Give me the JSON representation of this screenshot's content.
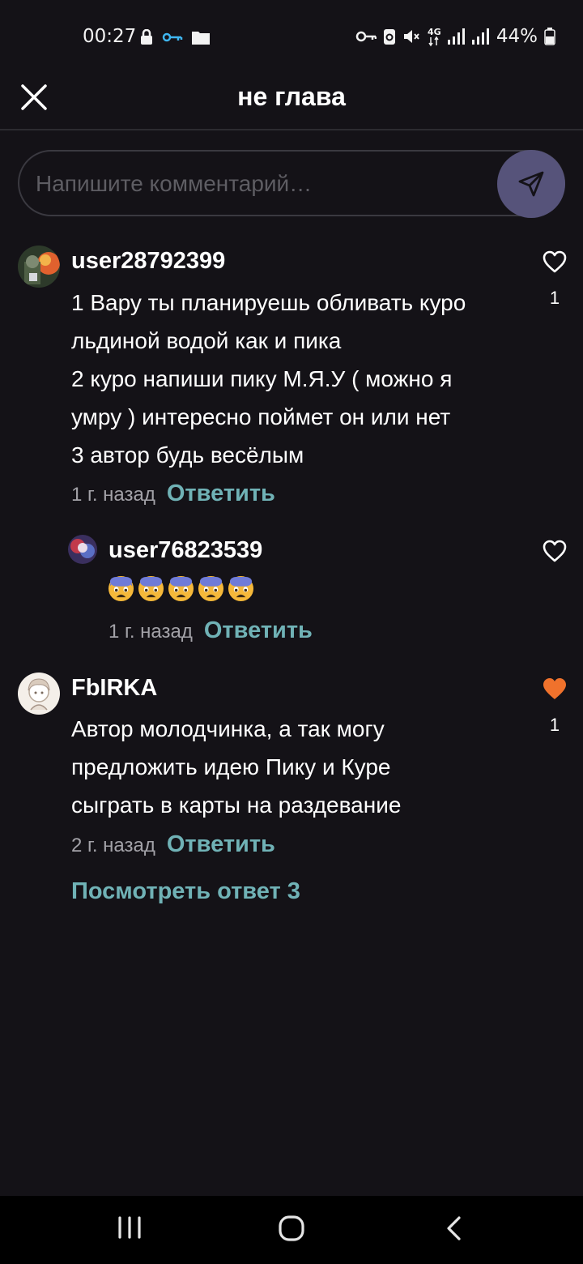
{
  "status_bar": {
    "time": "00:27",
    "battery_percent": "44%",
    "network": "4G"
  },
  "header": {
    "title": "не глава"
  },
  "comment_input": {
    "placeholder": "Напишите комментарий…"
  },
  "comments": [
    {
      "username": "user28792399",
      "lines": [
        "1 Вару ты планируешь обливать куро",
        "льдиной водой как и пика",
        "2 куро напиши пику М.Я.У ( можно я",
        "умру ) интересно поймет он или нет",
        "3 автор будь весёлым"
      ],
      "time": "1 г. назад",
      "reply_label": "Ответить",
      "like_count": "1",
      "liked": false,
      "replies": [
        {
          "username": "user76823539",
          "emoji": [
            "😨",
            "😨",
            "😨",
            "😨",
            "😨"
          ],
          "time": "1 г. назад",
          "reply_label": "Ответить",
          "liked": false
        }
      ]
    },
    {
      "username": "FbIRKA",
      "lines": [
        "Автор молодчинка, а так могу",
        "предложить идею Пику и Куре",
        "сыграть в карты на раздевание"
      ],
      "time": "2 г. назад",
      "reply_label": "Ответить",
      "like_count": "1",
      "liked": true,
      "view_replies_label": "Посмотреть ответ 3"
    }
  ],
  "colors": {
    "background": "#141217",
    "accent_teal": "#70b2b6",
    "liked_heart": "#f0722c",
    "send_button": "#56537a"
  }
}
